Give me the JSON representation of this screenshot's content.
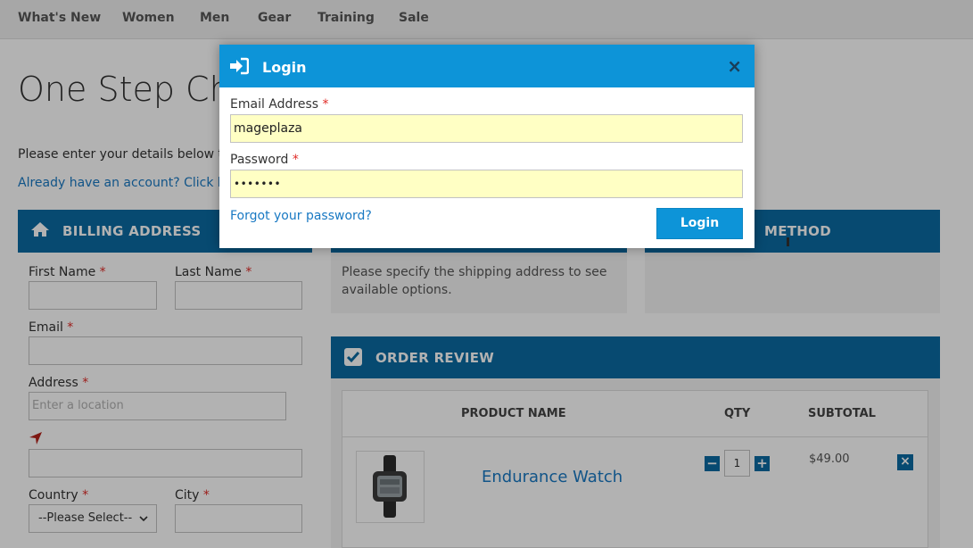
{
  "nav": {
    "items": [
      "What's New",
      "Women",
      "Men",
      "Gear",
      "Training",
      "Sale"
    ]
  },
  "page": {
    "title": "One Step Ch",
    "intro": "Please enter your details below to c",
    "login_link": "Already have an account? Click her"
  },
  "billing": {
    "title": "BILLING ADDRESS",
    "first_name_label": "First Name",
    "last_name_label": "Last Name",
    "email_label": "Email",
    "address_label": "Address",
    "address_placeholder": "Enter a location",
    "country_label": "Country",
    "country_value": "--Please Select--",
    "city_label": "City",
    "required_mark": "*"
  },
  "shipping": {
    "message": "Please specify the shipping address to see available options."
  },
  "payment": {
    "title_fragment": "METHOD"
  },
  "review": {
    "title": "ORDER REVIEW",
    "columns": [
      "PRODUCT NAME",
      "QTY",
      "SUBTOTAL"
    ],
    "item": {
      "name": "Endurance Watch",
      "qty": "1",
      "subtotal": "$49.00",
      "minus": "−",
      "plus": "+",
      "remove": "×"
    }
  },
  "modal": {
    "title": "Login",
    "close": "×",
    "email_label": "Email Address",
    "email_value": "mageplaza",
    "password_label": "Password",
    "password_value": "•••••••",
    "required_mark": "*",
    "forgot": "Forgot your password?",
    "login_button": "Login"
  },
  "colors": {
    "header_blue": "#0b6aa2",
    "modal_blue": "#0d94d8",
    "link_blue": "#1979c3",
    "autofill_yellow": "#ffffc4",
    "required_red": "#e02b27"
  }
}
